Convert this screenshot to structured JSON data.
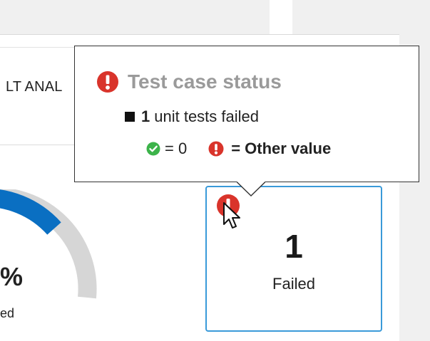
{
  "tab": {
    "label": "LT ANAL"
  },
  "gauge": {
    "percent_text": "%",
    "sub_text": "ed",
    "arc_color": "#0a6fc2",
    "track_color": "#d6d6d6"
  },
  "status_card": {
    "count": "1",
    "label": "Failed",
    "icon": "error-circle-icon",
    "border_color": "#3a9ad9"
  },
  "tooltip": {
    "title": "Test case status",
    "title_icon": "error-circle-icon",
    "line1": {
      "count": "1",
      "text": "unit tests failed"
    },
    "legend": {
      "ok_icon": "check-circle-icon",
      "ok_text": "= 0",
      "other_icon": "error-circle-icon",
      "other_text": "= Other value"
    }
  },
  "colors": {
    "error": "#d9342b",
    "success": "#3cb34a"
  }
}
